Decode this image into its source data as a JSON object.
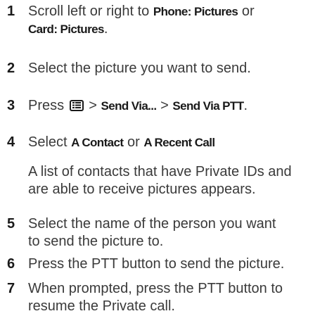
{
  "steps": [
    {
      "num": "1",
      "t1": "Scroll left or right to ",
      "b1": "Phone: Pictures",
      "t2": " or",
      "b2": "Card: Pictures",
      "t3": "."
    },
    {
      "num": "2",
      "text": "Select the picture you want to send."
    },
    {
      "num": "3",
      "t1": "Press ",
      "sep1": " > ",
      "b1": "Send Via...",
      "sep2": " > ",
      "b2": "Send Via PTT",
      "t2": "."
    },
    {
      "num": "4",
      "t1": "Select ",
      "b1": "A Contact",
      "t2": " or ",
      "b2": "A Recent Call",
      "note_line1": "A list of contacts that have Private IDs and",
      "note_line2": "are able to receive pictures appears."
    },
    {
      "num": "5",
      "line1": "Select the name of the person you want",
      "line2": "to send the picture to."
    },
    {
      "num": "6",
      "text": "Press the PTT button to send the picture."
    },
    {
      "num": "7",
      "line1": "When prompted, press the PTT button to",
      "line2": "resume the Private call."
    }
  ],
  "icons": {
    "menu_key": "menu-key-icon"
  }
}
